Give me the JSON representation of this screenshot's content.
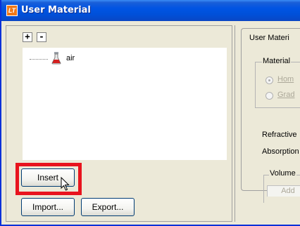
{
  "window": {
    "title": "User Material",
    "icon": "lt-app-icon"
  },
  "tree": {
    "expand_label": "+",
    "collapse_label": "-",
    "items": [
      {
        "label": "air",
        "icon": "flask-icon"
      }
    ]
  },
  "buttons": {
    "insert": "Insert",
    "import": "Import...",
    "export": "Export..."
  },
  "right_panel": {
    "group_title": "User Materi",
    "material_group_title": "Material",
    "radio_options": [
      {
        "label": "Hom",
        "selected": true
      },
      {
        "label": "Grad",
        "selected": false
      }
    ],
    "refractive_label": "Refractive",
    "absorption_label": "Absorption",
    "volume_group_title": "Volume",
    "add_label": "Add"
  },
  "colors": {
    "highlight": "#e8141e",
    "titlebar": "#0054e3",
    "background": "#ece9d8"
  }
}
